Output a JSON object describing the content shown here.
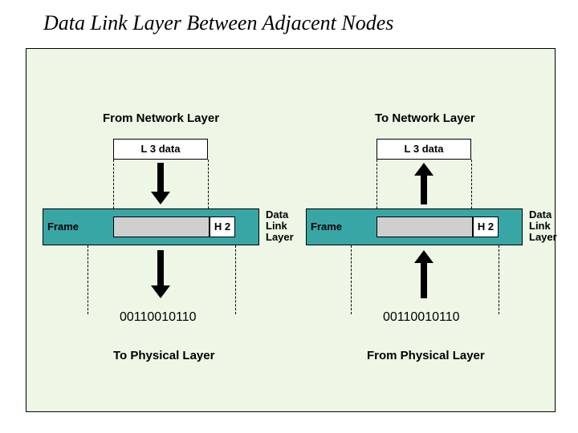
{
  "title": "Data Link Layer Between Adjacent Nodes",
  "left": {
    "top": "From Network Layer",
    "l3": "L 3 data",
    "frame": "Frame",
    "h2": "H 2",
    "dll": "Data\nLink\nLayer",
    "bits": "00110010110",
    "bottom": "To Physical Layer"
  },
  "right": {
    "top": "To Network Layer",
    "l3": "L 3 data",
    "frame": "Frame",
    "h2": "H 2",
    "dll": "Data\nLink\nLayer",
    "bits": "00110010110",
    "bottom": "From Physical Layer"
  }
}
